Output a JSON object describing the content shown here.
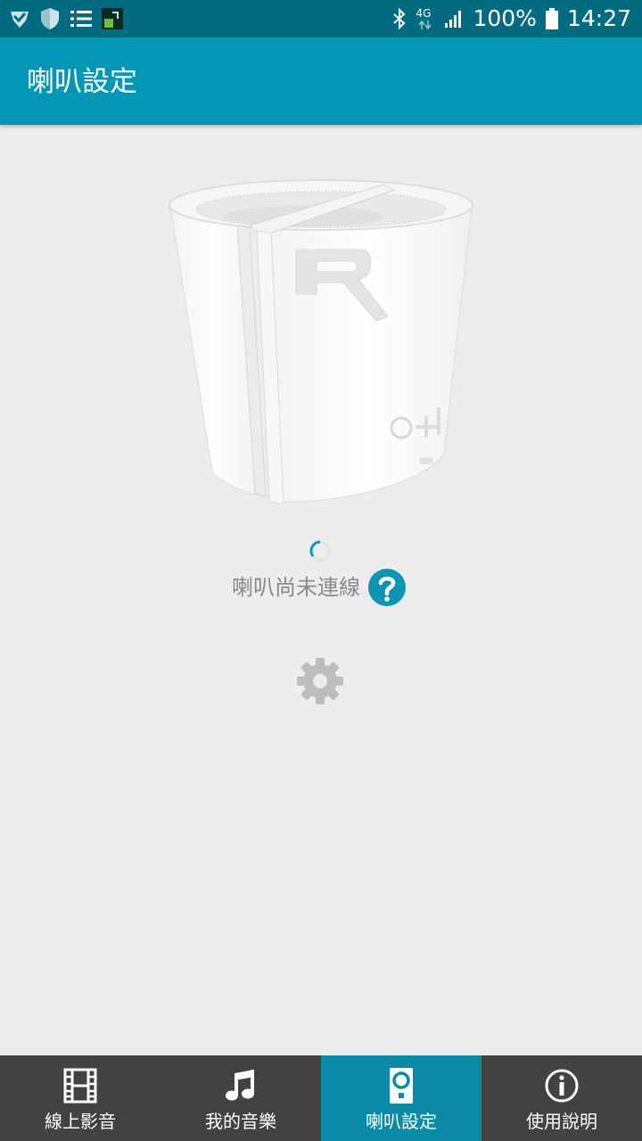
{
  "status_bar": {
    "network": "4G",
    "battery": "100%",
    "time": "14:27"
  },
  "app_bar": {
    "title": "喇叭設定"
  },
  "main": {
    "connection_status": "喇叭尚未連線"
  },
  "bottom_nav": {
    "items": [
      {
        "label": "線上影音",
        "icon": "film-icon",
        "active": false
      },
      {
        "label": "我的音樂",
        "icon": "music-note-icon",
        "active": false
      },
      {
        "label": "喇叭設定",
        "icon": "speaker-icon",
        "active": true
      },
      {
        "label": "使用說明",
        "icon": "info-icon",
        "active": false
      }
    ]
  },
  "colors": {
    "status_bar": "#026b80",
    "app_bar": "#0496b5",
    "accent": "#0e94b4",
    "bottom_nav": "#424242",
    "bottom_nav_active": "#0b8aa6",
    "background": "#ededed"
  }
}
